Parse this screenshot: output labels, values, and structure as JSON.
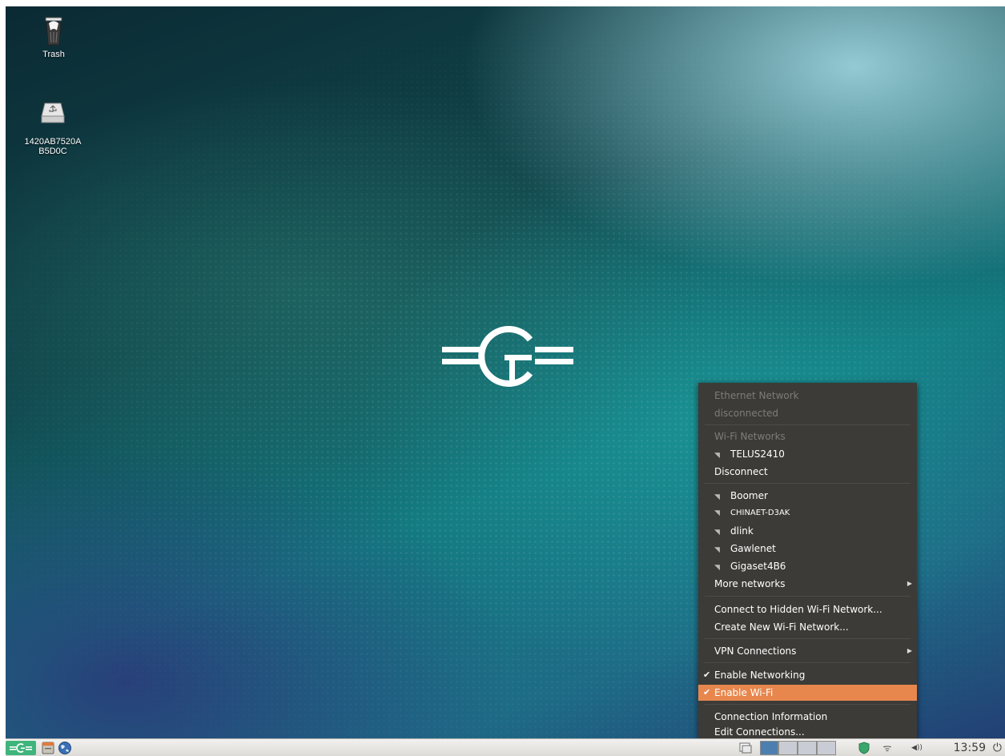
{
  "desktop": {
    "icons": [
      {
        "label": "Trash",
        "icon": "trash-icon"
      },
      {
        "label": "1420AB7520A\nB5D0C",
        "icon": "usb-drive-icon"
      }
    ],
    "logo": "center-logo"
  },
  "network_menu": {
    "ethernet_header": "Ethernet Network",
    "ethernet_status": "disconnected",
    "wifi_header": "Wi-Fi Networks",
    "connected_network": "TELUS2410",
    "disconnect_label": "Disconnect",
    "networks": [
      "Boomer",
      "CHINAET-D3AK",
      "dlink",
      "Gawlenet",
      "Gigaset4B6"
    ],
    "more_networks": "More networks",
    "connect_hidden": "Connect to Hidden Wi-Fi Network...",
    "create_new": "Create New Wi-Fi Network...",
    "vpn_connections": "VPN Connections",
    "enable_networking": "Enable Networking",
    "enable_wifi": "Enable Wi-Fi",
    "connection_info": "Connection Information",
    "edit_connections": "Edit Connections...",
    "highlight_color": "#e7874e"
  },
  "taskbar": {
    "clock": "13:59",
    "volume_label": "◀))",
    "icons": [
      "menu-button-icon",
      "file-manager-icon",
      "browser-globe-icon",
      "window-list-icon",
      "workspace-switcher",
      "update-shield-icon",
      "wifi-icon",
      "volume-icon",
      "power-icon"
    ]
  }
}
